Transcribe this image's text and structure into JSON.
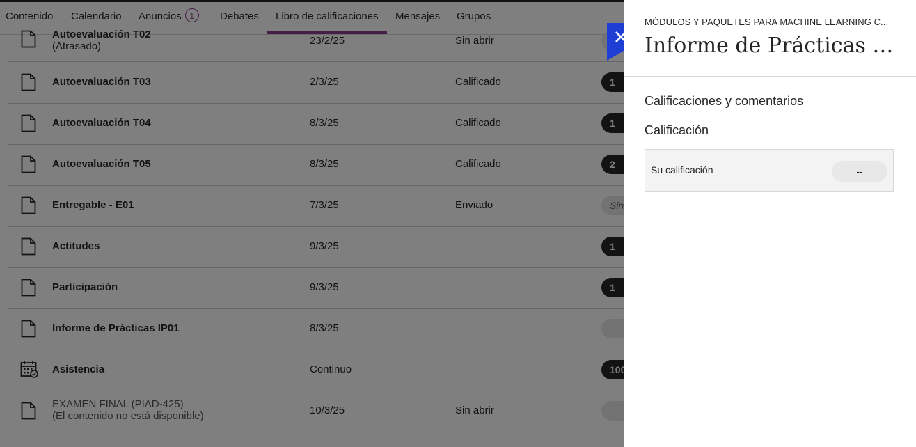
{
  "tabs": [
    {
      "label": "Contenido"
    },
    {
      "label": "Calendario"
    },
    {
      "label": "Anuncios",
      "badge": "1"
    },
    {
      "label": "Debates"
    },
    {
      "label": "Libro de calificaciones",
      "active": true
    },
    {
      "label": "Mensajes"
    },
    {
      "label": "Grupos"
    }
  ],
  "rows": [
    {
      "title": "Autoevaluación T02",
      "subtitle": "(Atrasado)",
      "date": "23/2/25",
      "status": "Sin abrir",
      "grade": "",
      "icon": "document-icon"
    },
    {
      "title": "Autoevaluación T03",
      "date": "2/3/25",
      "status": "Calificado",
      "grade": "1",
      "icon": "document-icon"
    },
    {
      "title": "Autoevaluación T04",
      "date": "8/3/25",
      "status": "Calificado",
      "grade": "1",
      "icon": "document-icon"
    },
    {
      "title": "Autoevaluación T05",
      "date": "8/3/25",
      "status": "Calificado",
      "grade": "2",
      "icon": "document-icon"
    },
    {
      "title": "Entregable - E01",
      "date": "7/3/25",
      "status": "Enviado",
      "grade": "Sin",
      "icon": "document-icon"
    },
    {
      "title": "Actitudes",
      "date": "9/3/25",
      "status": "",
      "grade": "1",
      "icon": "document-icon"
    },
    {
      "title": "Participación",
      "date": "9/3/25",
      "status": "",
      "grade": "1",
      "icon": "document-icon"
    },
    {
      "title": "Informe de Prácticas IP01",
      "date": "8/3/25",
      "status": "",
      "grade": "",
      "icon": "document-icon"
    },
    {
      "title": "Asistencia",
      "date": "Continuo",
      "status": "",
      "grade": "100",
      "icon": "attendance-calendar-icon"
    },
    {
      "title": "EXAMEN FINAL (PIAD-425)",
      "subtitle": "(El contenido no está disponible)",
      "date": "10/3/25",
      "status": "Sin abrir",
      "grade": "",
      "icon": "document-icon"
    }
  ],
  "panel": {
    "course": "MÓDULOS Y PAQUETES PARA MACHINE LEARNING C...",
    "title": "Informe de Prácticas IP...",
    "section_heading": "Calificaciones y comentarios",
    "grade_heading": "Calificación",
    "grade_label": "Su calificación",
    "grade_value": "--",
    "close_icon": "close-icon"
  },
  "colors": {
    "accent": "#8b3b8e",
    "close_button": "#1d3fd4",
    "pill_dark": "#262626"
  }
}
